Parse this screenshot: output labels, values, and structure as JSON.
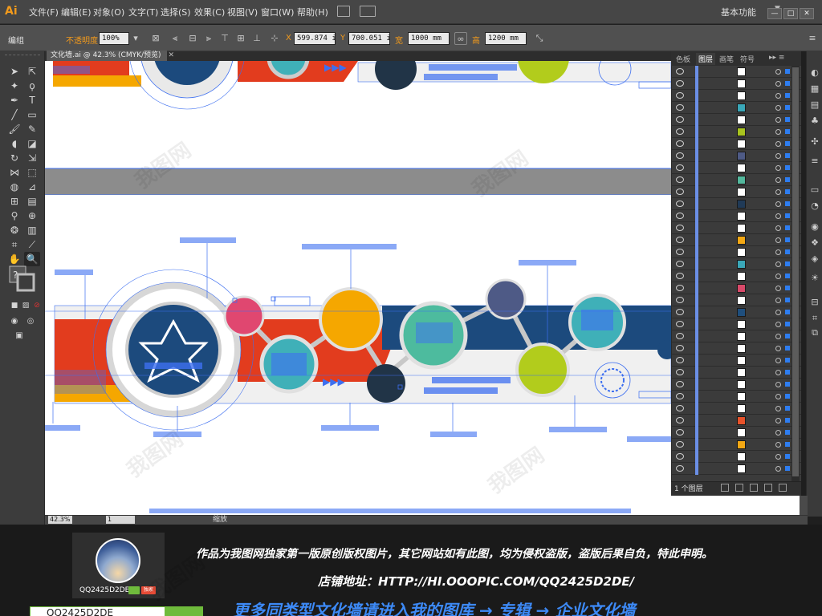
{
  "app": {
    "logo": "Ai",
    "menu": [
      "文件(F)",
      "编辑(E)",
      "对象(O)",
      "文字(T)",
      "选择(S)",
      "效果(C)",
      "视图(V)",
      "窗口(W)",
      "帮助(H)"
    ],
    "workspace": "基本功能",
    "window_buttons": [
      "—",
      "□",
      "✕"
    ]
  },
  "control_bar": {
    "selection_label": "编组",
    "opacity_label": "不透明度",
    "opacity_value": "100%",
    "x_label": "X",
    "x_value": "599.874 i",
    "y_label": "Y",
    "y_value": "700.051 i",
    "w_label": "宽",
    "w_value": "1000 mm",
    "h_label": "高",
    "h_value": "1200 mm"
  },
  "document": {
    "tab_title": "文化墙.ai @ 42.3% (CMYK/预览)",
    "tab_close": "✕"
  },
  "status_bar": {
    "zoom": "42.3%",
    "page": "1",
    "status": "缩放"
  },
  "layers_panel": {
    "tabs": [
      "色板",
      "图层",
      "画笔",
      "符号"
    ],
    "active_tab": "图层",
    "menu_icon": "▸▸ ≡",
    "layer_count": "1 个图层",
    "thumb_colors": [
      "#ffffff",
      "#ffffff",
      "#ffffff",
      "#3aa7b8",
      "#ffffff",
      "#a9c41f",
      "#ffffff",
      "#4f5b86",
      "#ffffff",
      "#53b89d",
      "#ffffff",
      "#203a57",
      "#ffffff",
      "#ffffff",
      "#f3a814",
      "#ffffff",
      "#3aa7b8",
      "#ffffff",
      "#d94a6a",
      "#ffffff",
      "#1f4f7e",
      "#ffffff",
      "#ffffff",
      "#ffffff",
      "#ffffff",
      "#ffffff",
      "#ffffff",
      "#ffffff",
      "#ffffff",
      "#e8522a",
      "#ffffff",
      "#f3a814",
      "#ffffff",
      "#ffffff"
    ],
    "footer_icons": [
      "locate-object-icon",
      "make-clipping-mask-icon",
      "create-sublayer-icon",
      "new-layer-icon",
      "delete-layer-icon"
    ]
  },
  "artwork": {
    "colors": {
      "red": "#e23c1e",
      "orange": "#f5a700",
      "navy": "#1c4a7d",
      "pink": "#e04770",
      "teal": "#3fb0b8",
      "green": "#b2cc1c",
      "slate": "#4e5a86",
      "dark": "#213447",
      "mint": "#4dbb9e",
      "selection": "#3d6ff0"
    }
  },
  "banner": {
    "shop_name": "QQ2425D2DE",
    "badge": "独家",
    "notice": "作品为我图网独家第一版原创版权图片，其它网站如有此图，均为侵权盗版，盗版后果自负，特此申明。",
    "address": "店铺地址：HTTP://HI.OOOPIC.COM/QQ2425D2DE/",
    "more": "更多同类型文化墙请进入我的图库 → 专辑 → 企业文化墙",
    "search_text": "QQ2425D2DE",
    "watermark": "我图网"
  }
}
